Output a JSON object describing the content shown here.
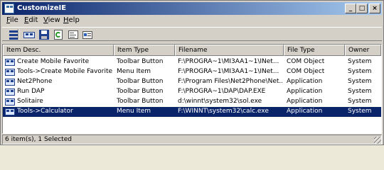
{
  "window": {
    "title": "CustomizeIE"
  },
  "titlebar_buttons": {
    "minimize": "_",
    "maximize": "□",
    "close": "×"
  },
  "menu": [
    {
      "label": "File"
    },
    {
      "label": "Edit"
    },
    {
      "label": "View"
    },
    {
      "label": "Help"
    }
  ],
  "toolbar": {
    "icons": [
      "tile-view-icon",
      "ieblock-icon",
      "save-icon",
      "refresh-icon",
      "properties-icon",
      "options-icon"
    ]
  },
  "columns": [
    "Item Desc.",
    "Item Type",
    "Filename",
    "File Type",
    "Owner"
  ],
  "rows": [
    {
      "desc": "Create Mobile Favorite",
      "type": "Toolbar Button",
      "filename": "F:\\PROGRA~1\\MI3AA1~1\\INet...",
      "filetype": "COM Object",
      "owner": "System"
    },
    {
      "desc": "Tools->Create Mobile Favorite...",
      "type": "Menu Item",
      "filename": "F:\\PROGRA~1\\MI3AA1~1\\INet...",
      "filetype": "COM Object",
      "owner": "System"
    },
    {
      "desc": "Net2Phone",
      "type": "Toolbar Button",
      "filename": "F:\\Program Files\\Net2Phone\\Net...",
      "filetype": "Application",
      "owner": "System"
    },
    {
      "desc": "Run DAP",
      "type": "Toolbar Button",
      "filename": "F:\\PROGRA~1\\DAP\\DAP.EXE",
      "filetype": "Application",
      "owner": "System"
    },
    {
      "desc": "Solitaire",
      "type": "Toolbar Button",
      "filename": "d:\\winnt\\system32\\sol.exe",
      "filetype": "Application",
      "owner": "System"
    },
    {
      "desc": "Tools->Calculator",
      "type": "Menu Item",
      "filename": "F:\\WINNT\\system32\\calc.exe",
      "filetype": "Application",
      "owner": "System"
    }
  ],
  "selected_row": 5,
  "status": {
    "text": "6 item(s), 1 Selected"
  },
  "colors": {
    "title_start": "#0a246a",
    "title_end": "#a6caf0",
    "selection": "#0a246a",
    "face": "#d4d0c8"
  }
}
